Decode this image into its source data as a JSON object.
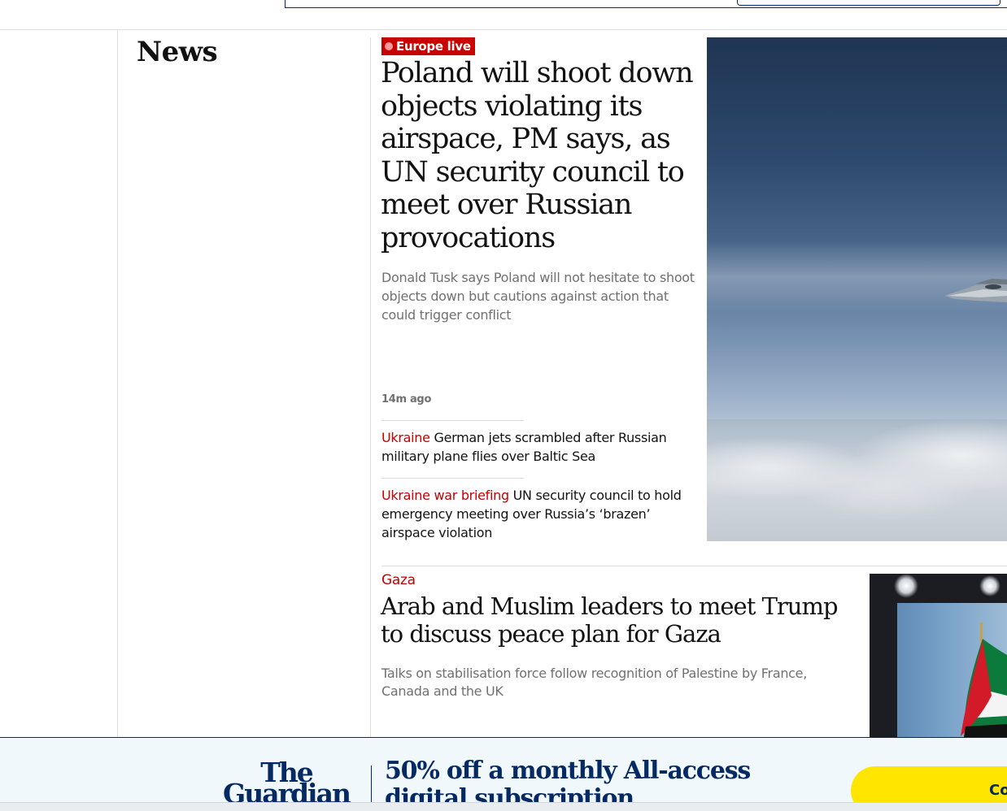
{
  "section": {
    "title": "News"
  },
  "lead": {
    "kicker": "Europe live",
    "headline": "Poland will shoot down objects violating its airspace, PM says, as UN security council to meet over Russian provocations",
    "standfirst": "Donald Tusk says Poland will not hesitate to shoot objects down but cautions against action that could trigger conflict",
    "timestamp": "14m ago",
    "sublinks": [
      {
        "kicker": "Ukraine",
        "text": "German jets scrambled after Russian military plane flies over Baltic Sea"
      },
      {
        "kicker": "Ukraine war briefing",
        "text": "UN security council to hold emergency meeting over Russia’s ‘brazen’ airspace violation"
      }
    ]
  },
  "story2": {
    "kicker": "Gaza",
    "headline": "Arab and Muslim leaders to meet Trump to discuss peace plan for Gaza",
    "standfirst": "Talks on stabilisation force follow recognition of Palestine by France, Canada and the UK"
  },
  "banner": {
    "logo_line1": "The",
    "logo_line2": "Guardian",
    "headline": "50% off a monthly All-access digital subscription",
    "cta": "Co"
  },
  "colors": {
    "accent_red": "#c70000",
    "brand_blue": "#052962",
    "cta_yellow": "#ffe500"
  }
}
